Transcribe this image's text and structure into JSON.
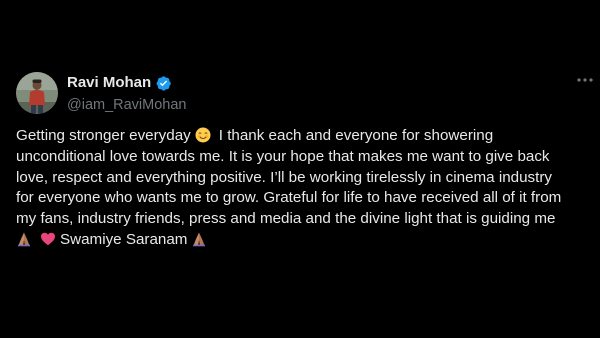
{
  "author": {
    "display_name": "Ravi Mohan",
    "handle": "@iam_RaviMohan",
    "verified": true
  },
  "tweet": {
    "lines": [
      "Getting stronger everyday",
      "I thank each and everyone for showering",
      "unconditional love towards me. It is your hope that makes me want to give back",
      "love, respect and everything positive. I’ll be working tirelessly in cinema industry",
      "for everyone who wants me to grow. Grateful for life to have received all of it from",
      "my fans, industry friends, press and media and the divine light that is guiding me",
      "Swamiye Saranam"
    ],
    "emojis": [
      "smiling-face-emoji",
      "folded-hands-emoji",
      "heart-emoji",
      "folded-hands-emoji"
    ]
  },
  "colors": {
    "background": "#000000",
    "text_primary": "#e7e9ea",
    "text_secondary": "#71767b",
    "verified_badge": "#1d9bf0"
  },
  "icons": {
    "more": "more-options-icon",
    "verified": "verified-badge-icon"
  }
}
